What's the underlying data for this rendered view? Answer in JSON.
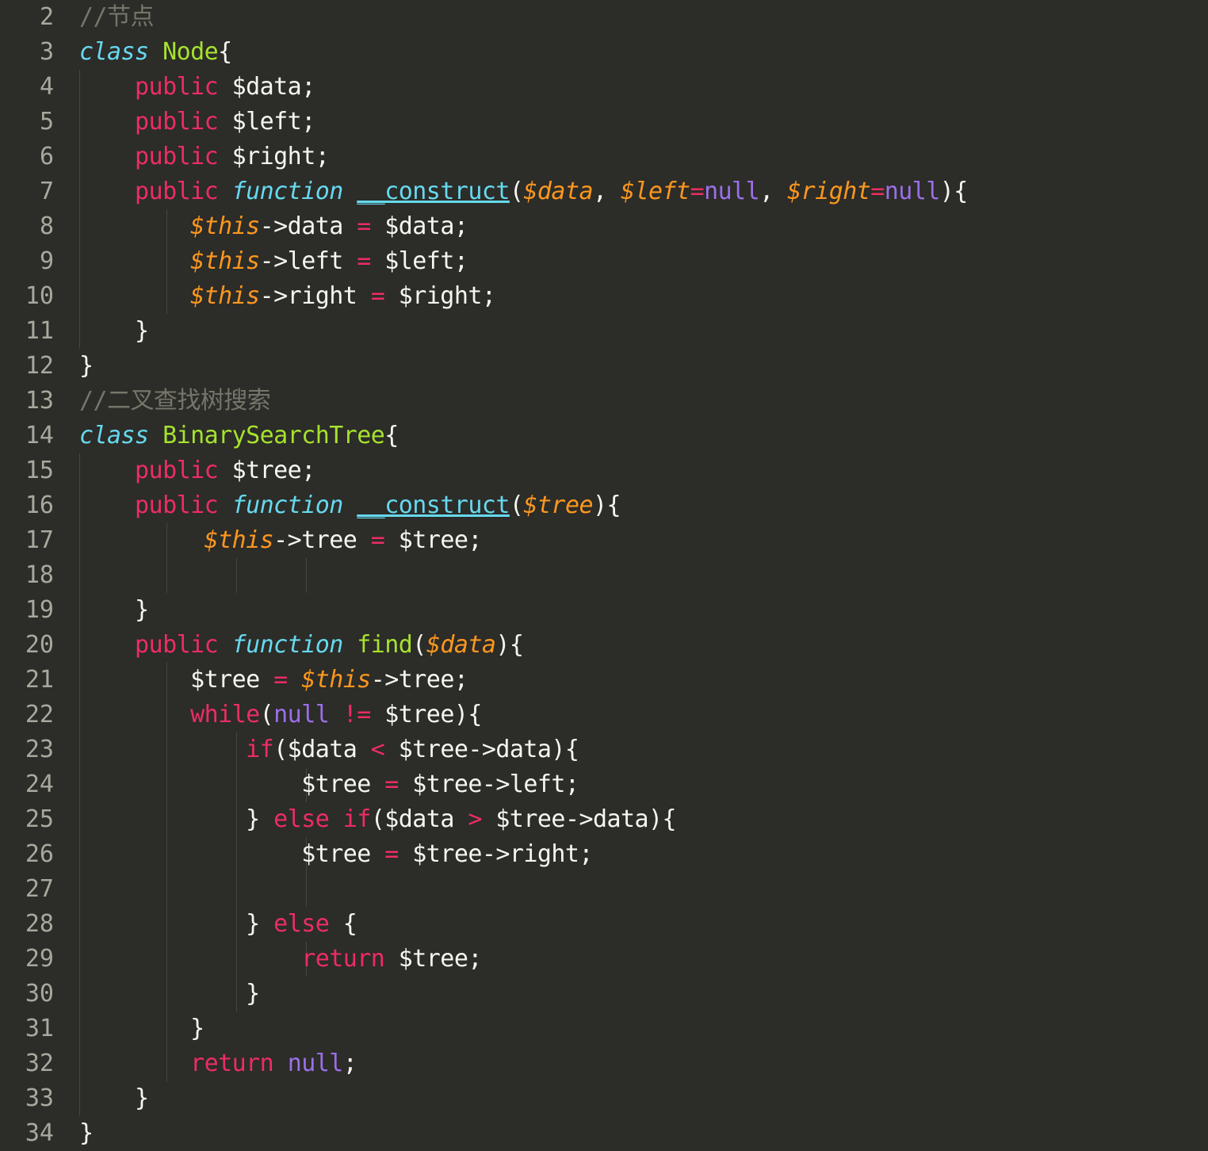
{
  "editor": {
    "language": "php",
    "theme": "monokai-dark",
    "background_color": "#2c2c28",
    "gutter_text_color": "#a8a89e",
    "indent_guide_color": "#4a4a44",
    "font_size_px": 30,
    "line_height_px": 44,
    "first_visible_line": 2,
    "last_visible_line": 34,
    "palette": {
      "plain": "#f6f6ef",
      "comment": "#75756a",
      "keyword": "#ec2d63",
      "keyword_italic_cyan": "#66d9ef",
      "type_green": "#a6e22e",
      "variable_orange": "#fd971f",
      "operator_pink": "#ec2d63",
      "null_purple": "#9b6fe8"
    },
    "indent_guides_x": [
      100,
      210,
      298,
      386,
      474
    ]
  },
  "code": {
    "lines": [
      {
        "number": "2",
        "indent": 0,
        "tokens": [
          {
            "t": "//节点",
            "c": "cm"
          }
        ]
      },
      {
        "number": "3",
        "indent": 0,
        "tokens": [
          {
            "t": "class",
            "c": "kwi"
          },
          {
            "t": " ",
            "c": "pl"
          },
          {
            "t": "Node",
            "c": "ty"
          },
          {
            "t": "{",
            "c": "pl"
          }
        ]
      },
      {
        "number": "4",
        "indent": 1,
        "tokens": [
          {
            "t": "public",
            "c": "kw"
          },
          {
            "t": " $data;",
            "c": "pl"
          }
        ]
      },
      {
        "number": "5",
        "indent": 1,
        "tokens": [
          {
            "t": "public",
            "c": "kw"
          },
          {
            "t": " $left;",
            "c": "pl"
          }
        ]
      },
      {
        "number": "6",
        "indent": 1,
        "tokens": [
          {
            "t": "public",
            "c": "kw"
          },
          {
            "t": " $right;",
            "c": "pl"
          }
        ]
      },
      {
        "number": "7",
        "indent": 1,
        "tokens": [
          {
            "t": "public",
            "c": "kw"
          },
          {
            "t": " ",
            "c": "pl"
          },
          {
            "t": "function",
            "c": "kwi"
          },
          {
            "t": " ",
            "c": "pl"
          },
          {
            "t": "__construct",
            "c": "fn"
          },
          {
            "t": "(",
            "c": "pl"
          },
          {
            "t": "$data",
            "c": "var"
          },
          {
            "t": ", ",
            "c": "pl"
          },
          {
            "t": "$left",
            "c": "var"
          },
          {
            "t": "=",
            "c": "op"
          },
          {
            "t": "null",
            "c": "nl"
          },
          {
            "t": ", ",
            "c": "pl"
          },
          {
            "t": "$right",
            "c": "var"
          },
          {
            "t": "=",
            "c": "op"
          },
          {
            "t": "null",
            "c": "nl"
          },
          {
            "t": "){",
            "c": "pl"
          }
        ]
      },
      {
        "number": "8",
        "indent": 2,
        "tokens": [
          {
            "t": "$this",
            "c": "var"
          },
          {
            "t": "->data ",
            "c": "pl"
          },
          {
            "t": "=",
            "c": "op"
          },
          {
            "t": " $data;",
            "c": "pl"
          }
        ]
      },
      {
        "number": "9",
        "indent": 2,
        "tokens": [
          {
            "t": "$this",
            "c": "var"
          },
          {
            "t": "->left ",
            "c": "pl"
          },
          {
            "t": "=",
            "c": "op"
          },
          {
            "t": " $left;",
            "c": "pl"
          }
        ]
      },
      {
        "number": "10",
        "indent": 2,
        "tokens": [
          {
            "t": "$this",
            "c": "var"
          },
          {
            "t": "->right ",
            "c": "pl"
          },
          {
            "t": "=",
            "c": "op"
          },
          {
            "t": " $right;",
            "c": "pl"
          }
        ]
      },
      {
        "number": "11",
        "indent": 1,
        "tokens": [
          {
            "t": "}",
            "c": "pl"
          }
        ]
      },
      {
        "number": "12",
        "indent": 0,
        "tokens": [
          {
            "t": "}",
            "c": "pl"
          }
        ]
      },
      {
        "number": "13",
        "indent": 0,
        "tokens": [
          {
            "t": "//二叉查找树搜索",
            "c": "cm"
          }
        ]
      },
      {
        "number": "14",
        "indent": 0,
        "tokens": [
          {
            "t": "class",
            "c": "kwi"
          },
          {
            "t": " ",
            "c": "pl"
          },
          {
            "t": "BinarySearchTree",
            "c": "ty"
          },
          {
            "t": "{",
            "c": "pl"
          }
        ]
      },
      {
        "number": "15",
        "indent": 1,
        "tokens": [
          {
            "t": "public",
            "c": "kw"
          },
          {
            "t": " $tree;",
            "c": "pl"
          }
        ]
      },
      {
        "number": "16",
        "indent": 1,
        "tokens": [
          {
            "t": "public",
            "c": "kw"
          },
          {
            "t": " ",
            "c": "pl"
          },
          {
            "t": "function",
            "c": "kwi"
          },
          {
            "t": " ",
            "c": "pl"
          },
          {
            "t": "__construct",
            "c": "fn"
          },
          {
            "t": "(",
            "c": "pl"
          },
          {
            "t": "$tree",
            "c": "var"
          },
          {
            "t": "){",
            "c": "pl"
          }
        ]
      },
      {
        "number": "17",
        "indent": 2,
        "tokens": [
          {
            "t": " ",
            "c": "pl"
          },
          {
            "t": "$this",
            "c": "var"
          },
          {
            "t": "->tree ",
            "c": "pl"
          },
          {
            "t": "=",
            "c": "op"
          },
          {
            "t": " $tree;",
            "c": "pl"
          }
        ]
      },
      {
        "number": "18",
        "indent": 0,
        "tokens": []
      },
      {
        "number": "19",
        "indent": 1,
        "tokens": [
          {
            "t": "}",
            "c": "pl"
          }
        ]
      },
      {
        "number": "20",
        "indent": 1,
        "tokens": [
          {
            "t": "public",
            "c": "kw"
          },
          {
            "t": " ",
            "c": "pl"
          },
          {
            "t": "function",
            "c": "kwi"
          },
          {
            "t": " ",
            "c": "pl"
          },
          {
            "t": "find",
            "c": "ty"
          },
          {
            "t": "(",
            "c": "pl"
          },
          {
            "t": "$data",
            "c": "var"
          },
          {
            "t": "){",
            "c": "pl"
          }
        ]
      },
      {
        "number": "21",
        "indent": 2,
        "tokens": [
          {
            "t": "$tree ",
            "c": "pl"
          },
          {
            "t": "=",
            "c": "op"
          },
          {
            "t": " ",
            "c": "pl"
          },
          {
            "t": "$this",
            "c": "var"
          },
          {
            "t": "->tree;",
            "c": "pl"
          }
        ]
      },
      {
        "number": "22",
        "indent": 2,
        "tokens": [
          {
            "t": "while",
            "c": "kw"
          },
          {
            "t": "(",
            "c": "pl"
          },
          {
            "t": "null",
            "c": "nl"
          },
          {
            "t": " ",
            "c": "pl"
          },
          {
            "t": "!=",
            "c": "op"
          },
          {
            "t": " $tree){",
            "c": "pl"
          }
        ]
      },
      {
        "number": "23",
        "indent": 3,
        "tokens": [
          {
            "t": "if",
            "c": "kw"
          },
          {
            "t": "($data ",
            "c": "pl"
          },
          {
            "t": "<",
            "c": "op"
          },
          {
            "t": " $tree->data){",
            "c": "pl"
          }
        ]
      },
      {
        "number": "24",
        "indent": 4,
        "tokens": [
          {
            "t": "$tree ",
            "c": "pl"
          },
          {
            "t": "=",
            "c": "op"
          },
          {
            "t": " $tree->left;",
            "c": "pl"
          }
        ]
      },
      {
        "number": "25",
        "indent": 3,
        "tokens": [
          {
            "t": "} ",
            "c": "pl"
          },
          {
            "t": "else",
            "c": "kw"
          },
          {
            "t": " ",
            "c": "pl"
          },
          {
            "t": "if",
            "c": "kw"
          },
          {
            "t": "($data ",
            "c": "pl"
          },
          {
            "t": ">",
            "c": "op"
          },
          {
            "t": " $tree->data){",
            "c": "pl"
          }
        ]
      },
      {
        "number": "26",
        "indent": 4,
        "tokens": [
          {
            "t": "$tree ",
            "c": "pl"
          },
          {
            "t": "=",
            "c": "op"
          },
          {
            "t": " $tree->right;",
            "c": "pl"
          }
        ]
      },
      {
        "number": "27",
        "indent": 0,
        "tokens": []
      },
      {
        "number": "28",
        "indent": 3,
        "tokens": [
          {
            "t": "} ",
            "c": "pl"
          },
          {
            "t": "else",
            "c": "kw"
          },
          {
            "t": " {",
            "c": "pl"
          }
        ]
      },
      {
        "number": "29",
        "indent": 4,
        "tokens": [
          {
            "t": "return",
            "c": "kw"
          },
          {
            "t": " $tree;",
            "c": "pl"
          }
        ]
      },
      {
        "number": "30",
        "indent": 3,
        "tokens": [
          {
            "t": "}",
            "c": "pl"
          }
        ]
      },
      {
        "number": "31",
        "indent": 2,
        "tokens": [
          {
            "t": "}",
            "c": "pl"
          }
        ]
      },
      {
        "number": "32",
        "indent": 2,
        "tokens": [
          {
            "t": "return",
            "c": "kw"
          },
          {
            "t": " ",
            "c": "pl"
          },
          {
            "t": "null",
            "c": "nl"
          },
          {
            "t": ";",
            "c": "pl"
          }
        ]
      },
      {
        "number": "33",
        "indent": 1,
        "tokens": [
          {
            "t": "}",
            "c": "pl"
          }
        ]
      },
      {
        "number": "34",
        "indent": 0,
        "tokens": [
          {
            "t": "}",
            "c": "pl"
          }
        ]
      }
    ]
  }
}
